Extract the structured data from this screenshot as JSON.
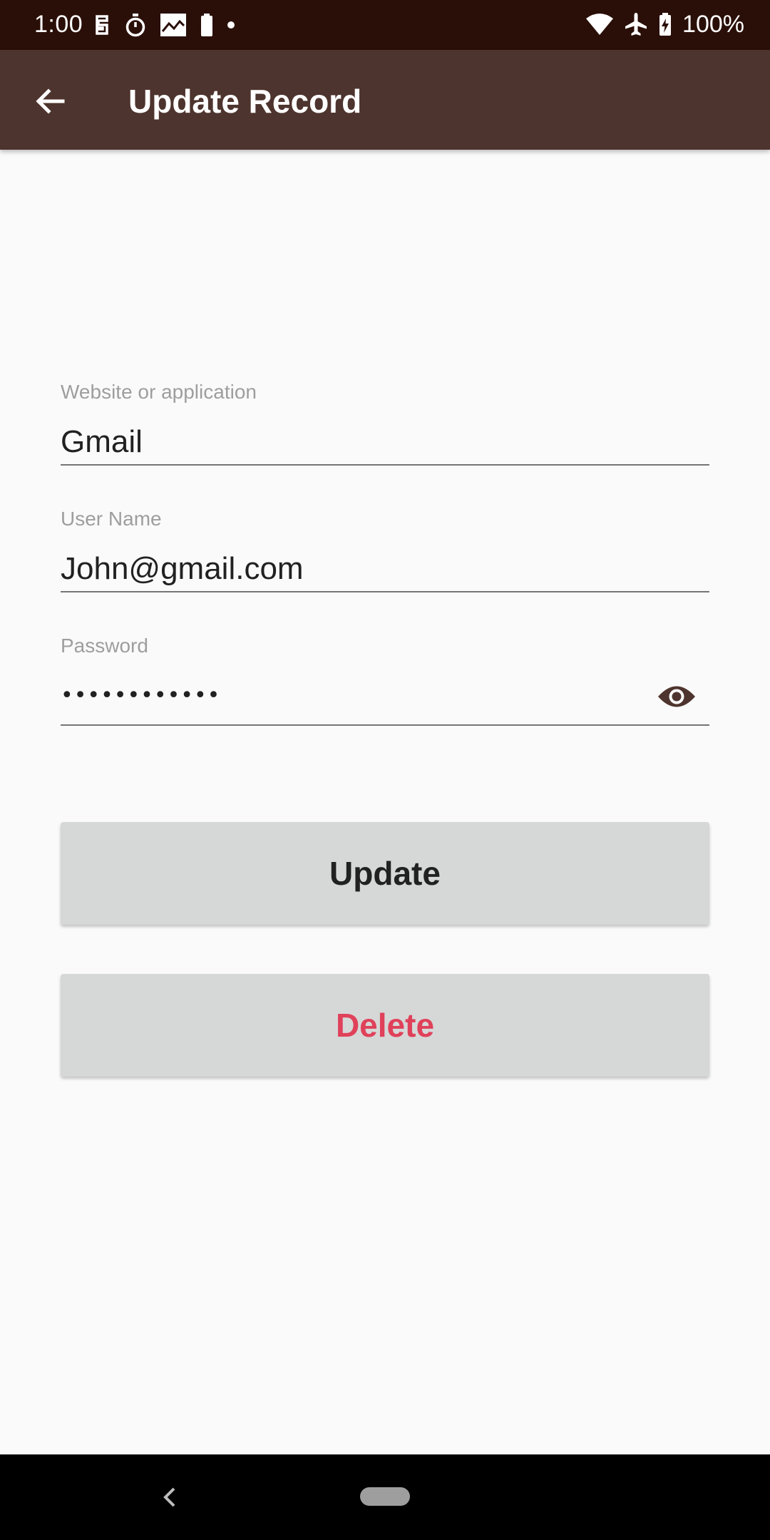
{
  "status_bar": {
    "time": "1:00",
    "battery_percent": "100%",
    "left_icons": [
      "sim-card-icon",
      "stopwatch-icon",
      "image-icon",
      "battery-icon",
      "dot-icon"
    ],
    "right_icons": [
      "wifi-icon",
      "airplane-icon",
      "battery-charging-icon"
    ]
  },
  "app_bar": {
    "title": "Update Record",
    "back_icon": "arrow-back-icon",
    "background": "#4e342e"
  },
  "form": {
    "website": {
      "label": "Website or application",
      "value": "Gmail"
    },
    "username": {
      "label": "User Name",
      "value": "John@gmail.com"
    },
    "password": {
      "label": "Password",
      "masked_value": "••••••••••••",
      "toggle_icon": "eye-icon"
    }
  },
  "buttons": {
    "update_label": "Update",
    "delete_label": "Delete",
    "delete_color": "#e0415a"
  },
  "nav_bar": {
    "back_icon": "nav-back-icon",
    "home_icon": "nav-home-pill-icon"
  }
}
